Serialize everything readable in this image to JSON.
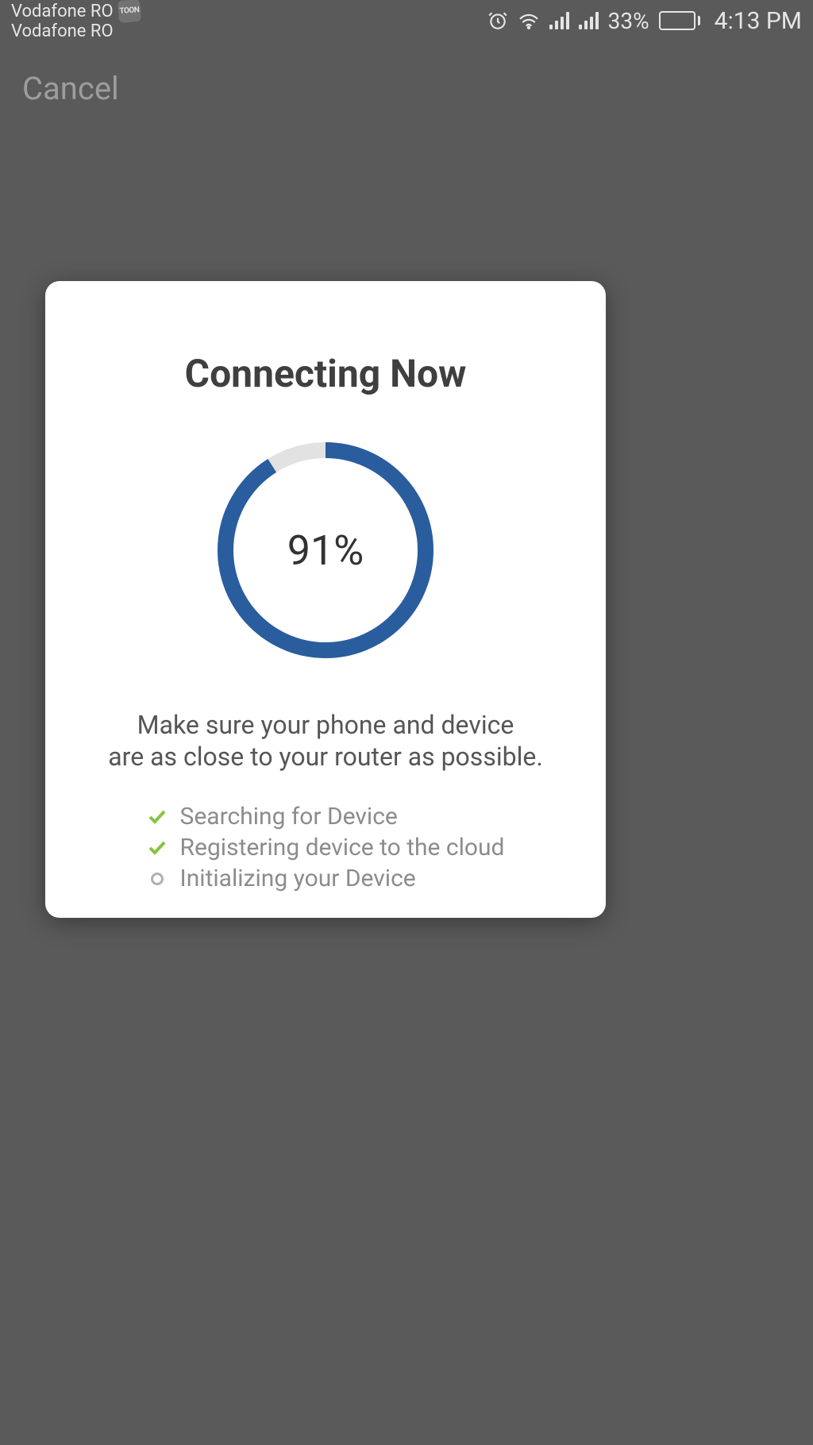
{
  "status_bar": {
    "carrier1": "Vodafone RO",
    "carrier2": "Vodafone RO",
    "battery_percent": "33%",
    "time": "4:13 PM"
  },
  "background": {
    "cancel_label": "Cancel"
  },
  "modal": {
    "title": "Connecting Now",
    "progress_percent": 91,
    "progress_label": "91%",
    "hint_line1": "Make sure your phone and device",
    "hint_line2": "are as close to your router as possible.",
    "steps": [
      {
        "label": "Searching for Device",
        "status": "done"
      },
      {
        "label": "Registering device to the cloud",
        "status": "done"
      },
      {
        "label": "Initializing your Device",
        "status": "pending"
      }
    ]
  },
  "colors": {
    "accent": "#2a5d9e",
    "success": "#86c440"
  }
}
